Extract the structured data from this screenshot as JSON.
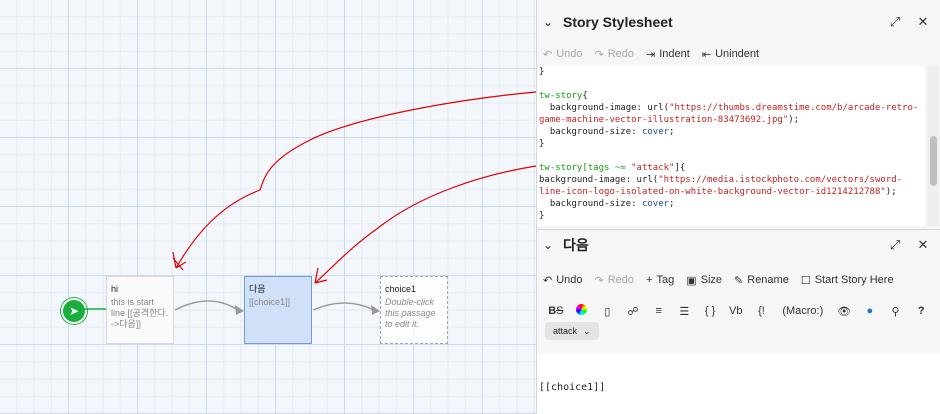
{
  "story_map": {
    "passages": [
      {
        "title": "hi",
        "excerpt": "this is start line [[공격한다. ->다음]]"
      },
      {
        "title": "다음",
        "excerpt": "[[choice1]]"
      },
      {
        "title": "choice1",
        "excerpt": "Double-click this passage to edit it."
      }
    ]
  },
  "stylesheet_dialog": {
    "title": "Story Stylesheet",
    "toolbar": {
      "undo": "Undo",
      "redo": "Redo",
      "indent": "Indent",
      "unindent": "Unindent"
    },
    "code": {
      "l0": "}",
      "r1_sel": "tw-story",
      "r1_brace": "{",
      "r2_prop": "  background-image: url(",
      "r2_str": "\"https://thumbs.dreamstime.com/b/arcade-retro-game-machine-vector-illustration-83473692.jpg\"",
      "r2_end": ");",
      "r3_prop": "  background-size: ",
      "r3_val": "cover",
      "r3_end": ";",
      "r4": "}",
      "r5_sel": "tw-story[tags ~= ",
      "r5_str": "\"attack\"",
      "r5_end": "]{",
      "r6_prop": "background-image: url(",
      "r6_str": "\"https://media.istockphoto.com/vectors/sword-line-icon-logo-isolated-on-white-background-vector-id1214212788\"",
      "r6_end": ");",
      "r7_prop": "  background-size: ",
      "r7_val": "cover",
      "r7_end": ";",
      "r8": "}"
    }
  },
  "passage_dialog": {
    "title": "다음",
    "toolbar": {
      "undo": "Undo",
      "redo": "Redo",
      "tag": "Tag",
      "size": "Size",
      "rename": "Rename",
      "start_story": "Start Story Here"
    },
    "format_bar": {
      "vb": "Vb",
      "macro": "(Macro:)"
    },
    "tag": "attack",
    "text": "[[choice1]]"
  },
  "colors": {
    "start": "#1aae3c",
    "selected": "#cfe0f8",
    "annotation": "#e00000"
  }
}
